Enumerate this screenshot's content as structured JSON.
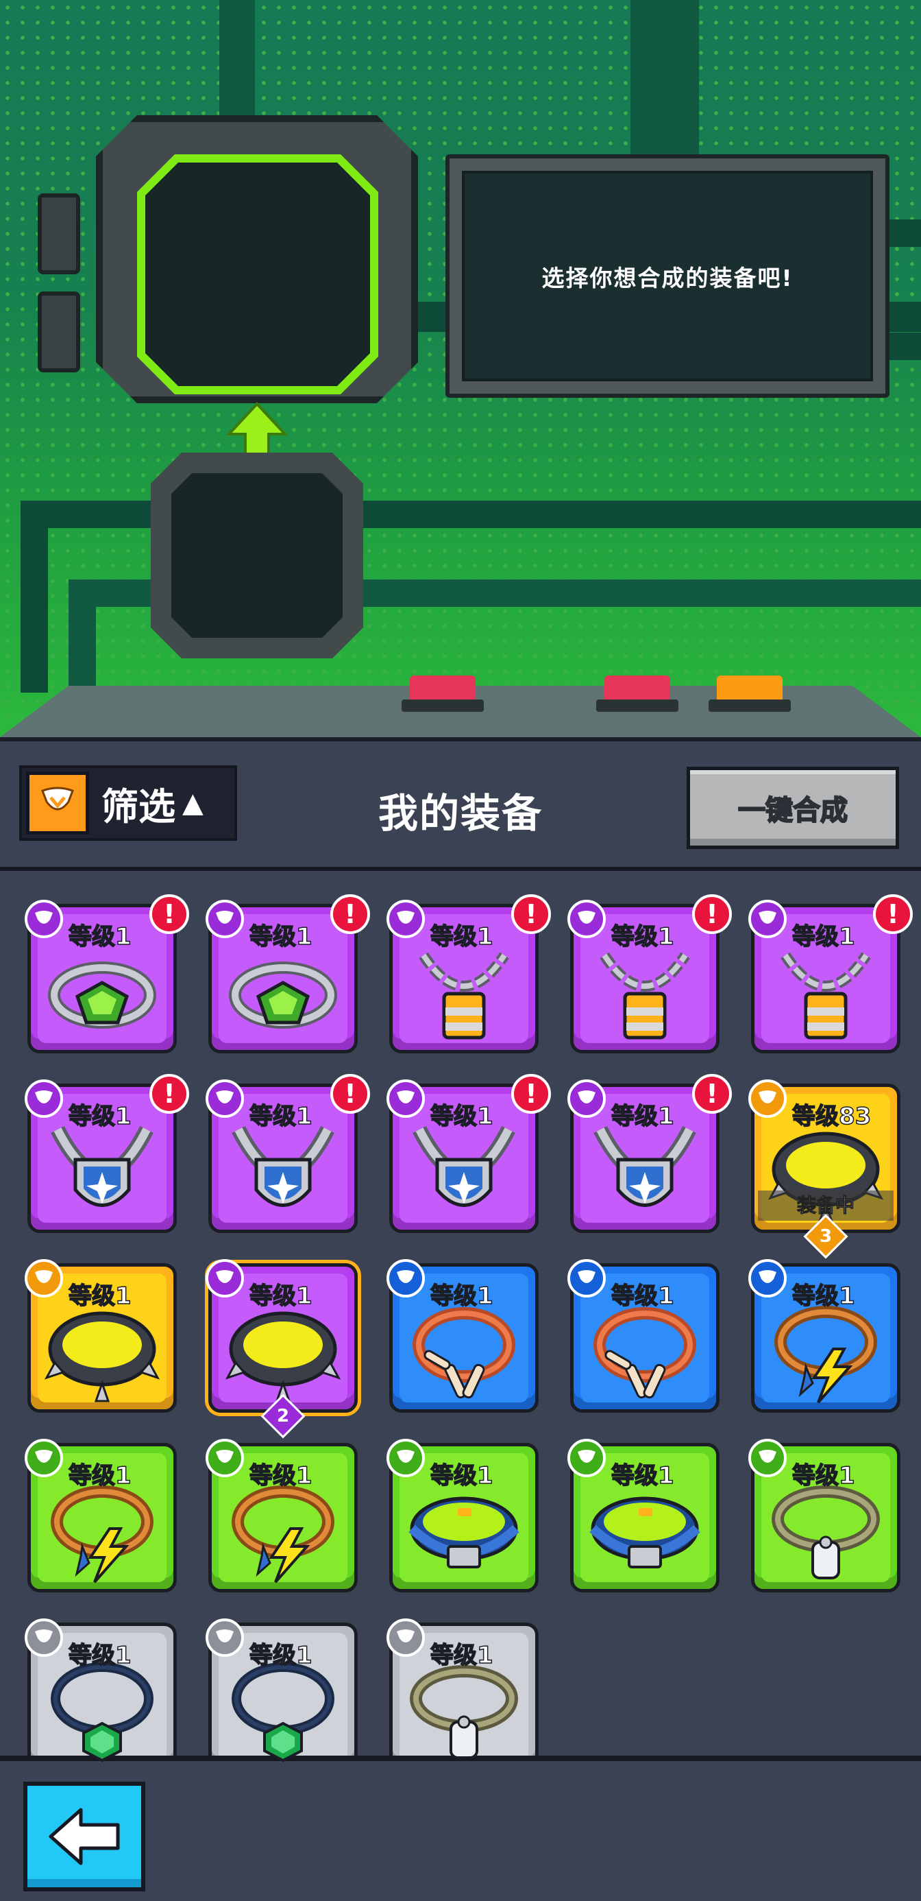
{
  "merge_station": {
    "message": "选择你想合成的装备吧!"
  },
  "inventory_header": {
    "filter_label": "筛选",
    "filter_caret": "▲",
    "title": "我的装备",
    "merge_all_label": "一键合成"
  },
  "colors": {
    "epic": "#b43ef0",
    "rare": "#1e76f0",
    "uncommon": "#64d820",
    "common": "#b8bcc4",
    "legendary": "#ffb21a",
    "alert": "#e8143c",
    "back_button": "#22c8f6"
  },
  "items": [
    {
      "level": "等级1",
      "rarity": "purple",
      "icon": "ring-green-gem-icon",
      "alert": "!"
    },
    {
      "level": "等级1",
      "rarity": "purple",
      "icon": "ring-green-gem-icon",
      "alert": "!"
    },
    {
      "level": "等级1",
      "rarity": "purple",
      "icon": "chain-padlock-necklace-icon",
      "alert": "!"
    },
    {
      "level": "等级1",
      "rarity": "purple",
      "icon": "chain-padlock-necklace-icon",
      "alert": "!"
    },
    {
      "level": "等级1",
      "rarity": "purple",
      "icon": "chain-padlock-necklace-icon",
      "alert": "!"
    },
    {
      "level": "等级1",
      "rarity": "purple",
      "icon": "shield-pendant-necklace-icon",
      "alert": "!"
    },
    {
      "level": "等级1",
      "rarity": "purple",
      "icon": "shield-pendant-necklace-icon",
      "alert": "!"
    },
    {
      "level": "等级1",
      "rarity": "purple",
      "icon": "shield-pendant-necklace-icon",
      "alert": "!"
    },
    {
      "level": "等级1",
      "rarity": "purple",
      "icon": "shield-pendant-necklace-icon",
      "alert": "!"
    },
    {
      "level": "等级83",
      "rarity": "gold",
      "icon": "spiked-collar-icon",
      "equipped": "装备中",
      "count": "3"
    },
    {
      "level": "等级1",
      "rarity": "gold",
      "icon": "spiked-collar-icon"
    },
    {
      "level": "等级1",
      "rarity": "purple",
      "icon": "spiked-collar-icon",
      "outlined": true,
      "count": "2"
    },
    {
      "level": "等级1",
      "rarity": "blue",
      "icon": "bone-collar-icon"
    },
    {
      "level": "等级1",
      "rarity": "blue",
      "icon": "bone-collar-icon"
    },
    {
      "level": "等级1",
      "rarity": "blue",
      "icon": "lightning-collar-icon"
    },
    {
      "level": "等级1",
      "rarity": "green",
      "icon": "lightning-collar-icon"
    },
    {
      "level": "等级1",
      "rarity": "green",
      "icon": "lightning-collar-icon"
    },
    {
      "level": "等级1",
      "rarity": "green",
      "icon": "blue-buckle-collar-icon"
    },
    {
      "level": "等级1",
      "rarity": "green",
      "icon": "blue-buckle-collar-icon"
    },
    {
      "level": "等级1",
      "rarity": "green",
      "icon": "dog-tag-collar-icon"
    },
    {
      "level": "等级1",
      "rarity": "gray",
      "icon": "emerald-necklace-icon"
    },
    {
      "level": "等级1",
      "rarity": "gray",
      "icon": "emerald-necklace-icon"
    },
    {
      "level": "等级1",
      "rarity": "gray",
      "icon": "dog-tag-collar-icon"
    }
  ]
}
